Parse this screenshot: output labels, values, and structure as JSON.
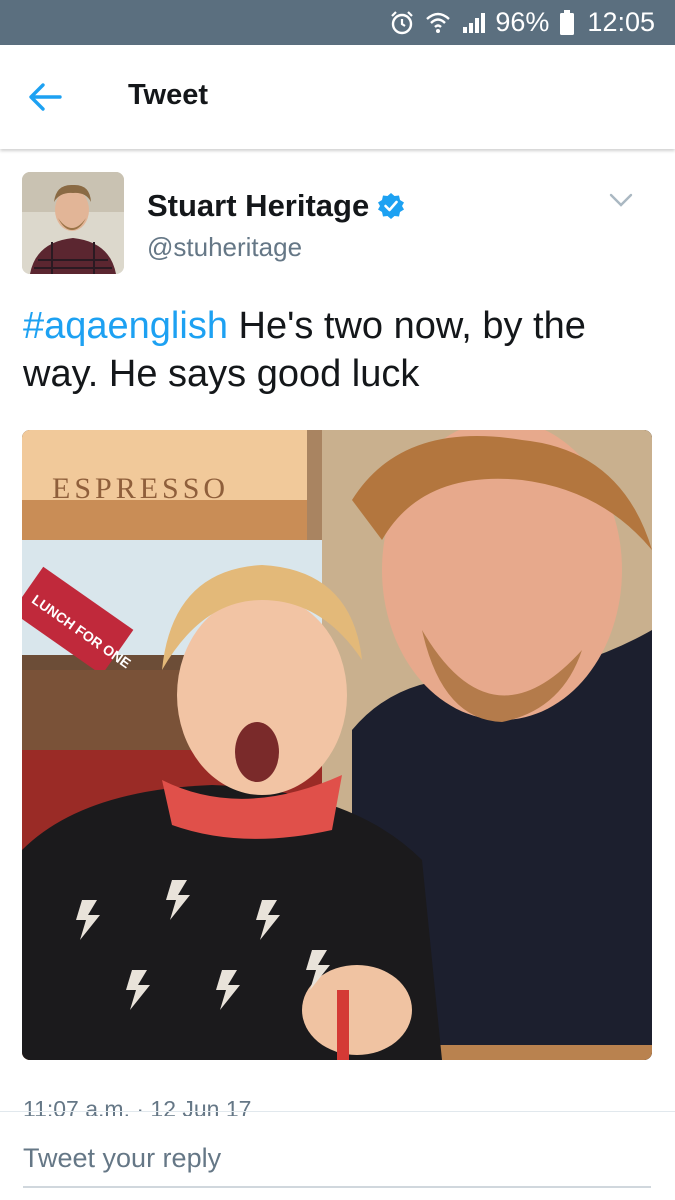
{
  "status_bar": {
    "battery": "96%",
    "time": "12:05"
  },
  "app_bar": {
    "title": "Tweet"
  },
  "tweet": {
    "author_name": "Stuart Heritage",
    "handle": "@stuheritage",
    "hashtag": "#aqaenglish",
    "text": " He's two now, by the way. He says good luck",
    "photo_sign": "ESPRESSO",
    "photo_poster": "LUNCH FOR ONE",
    "timestamp": "11:07 a.m. · 12 Jun 17"
  },
  "reply": {
    "placeholder": "Tweet your reply"
  },
  "colors": {
    "accent": "#1da1f2",
    "status_bar": "#5b6f7f",
    "secondary_text": "#657786"
  }
}
